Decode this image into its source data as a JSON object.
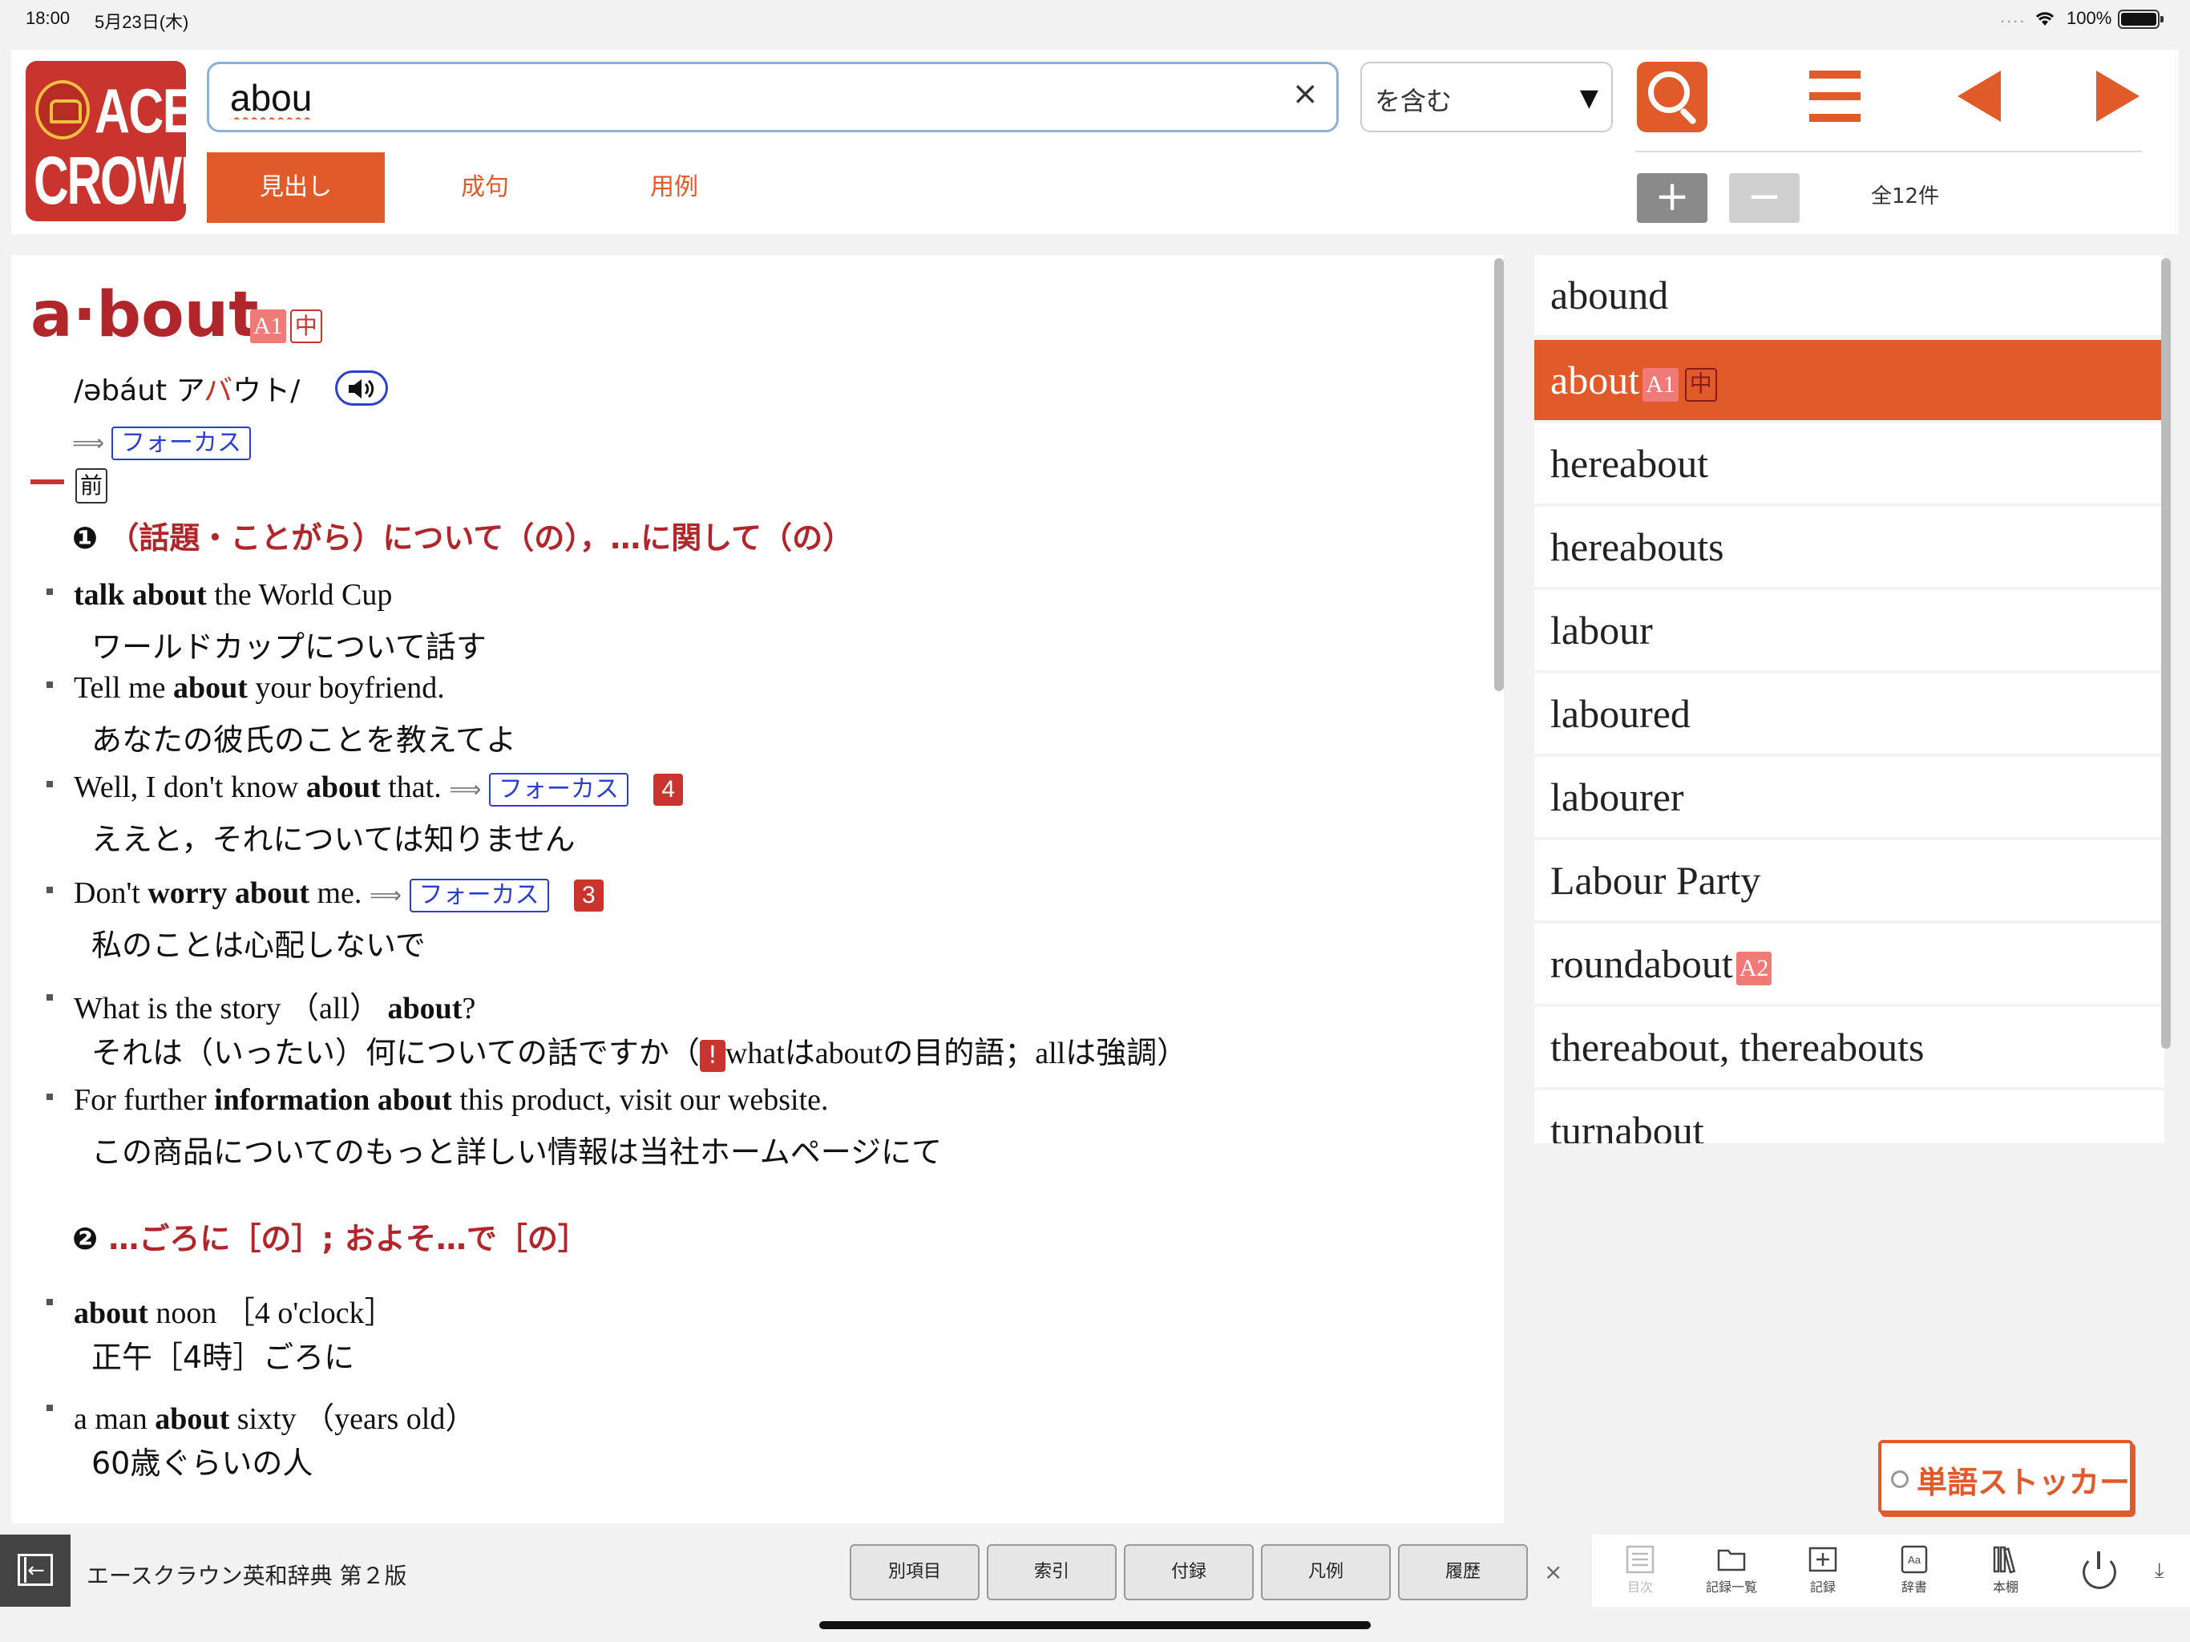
{
  "status": {
    "time": "18:00",
    "date": "5月23日(木)",
    "dots": "....",
    "battery": "100%"
  },
  "logo": {
    "line1": "ACE",
    "line2": "CROWN"
  },
  "search": {
    "value": "abou",
    "clear": "×",
    "mode": "を含む",
    "mode_arrow": "▼"
  },
  "tabs": [
    {
      "label": "見出し"
    },
    {
      "label": "成句"
    },
    {
      "label": "用例"
    }
  ],
  "zoom": {
    "plus": "+",
    "minus": "−"
  },
  "result_count": "全12件",
  "entry": {
    "headword": "a·bout",
    "level": "A1",
    "grade": "中",
    "pron_a": "/əbáut",
    "pron_kana1": "ア",
    "pron_kana2": "バ",
    "pron_kana3": "ウト/",
    "focus": "フォーカス",
    "pos": "前",
    "sense1": {
      "num": "❶",
      "text": "（話題・ことがら）について（の），…に関して（の）"
    },
    "sense2": {
      "num": "❷",
      "text": "…ごろに［の］; およそ…で［の］"
    },
    "examples": [
      {
        "pre": "",
        "bold": "talk about",
        "post": " the World Cup",
        "ja": "ワールドカップについて話す"
      },
      {
        "pre": "Tell me ",
        "bold": "about",
        "post": " your boyfriend.",
        "ja": "あなたの彼氏のことを教えてよ"
      },
      {
        "pre": "Well, I don't know ",
        "bold": "about",
        "post": " that.",
        "focus": "フォーカス",
        "badge": "4",
        "ja": "ええと，それについては知りません"
      },
      {
        "pre": "Don't ",
        "bold": "worry about",
        "post": " me.",
        "focus": "フォーカス",
        "badge": "3",
        "ja": "私のことは心配しないで"
      },
      {
        "pre": "What is the story （all） ",
        "bold": "about",
        "post": "?",
        "ja_pre": "それは（いったい）何についての話ですか（",
        "ja_excl": "!",
        "ja_post": "whatはaboutの目的語；allは強調）"
      },
      {
        "pre": "For further ",
        "bold": "information about",
        "post": " this product, visit our website.",
        "ja": "この商品についてのもっと詳しい情報は当社ホームページにて"
      },
      {
        "pre": "",
        "bold": "about",
        "post": " noon ［4 o'clock］",
        "ja": "正午［4時］ごろに"
      },
      {
        "pre": "a man ",
        "bold": "about",
        "post": " sixty （years old）",
        "ja": "60歳ぐらいの人"
      }
    ]
  },
  "results": [
    {
      "word": "abound"
    },
    {
      "word": "about",
      "level": "A1",
      "grade": "中"
    },
    {
      "word": "hereabout"
    },
    {
      "word": "hereabouts"
    },
    {
      "word": "labour"
    },
    {
      "word": "laboured"
    },
    {
      "word": "labourer"
    },
    {
      "word": "Labour Party"
    },
    {
      "word": "roundabout",
      "level": "A2"
    },
    {
      "word": "thereabout, thereabouts"
    },
    {
      "word": "turnabout"
    }
  ],
  "stocker": "単語ストッカー",
  "bottom": {
    "dict_name": "エースクラウン英和辞典 第２版",
    "buttons": [
      "別項目",
      "索引",
      "付録",
      "凡例",
      "履歴"
    ],
    "close": "×",
    "tools": [
      "目次",
      "記録一覧",
      "記録",
      "辞書",
      "本棚"
    ],
    "download": "⤓"
  },
  "colors": {
    "accent": "#e05a2a",
    "headword": "#b0262a",
    "link": "#2a3fd0"
  }
}
